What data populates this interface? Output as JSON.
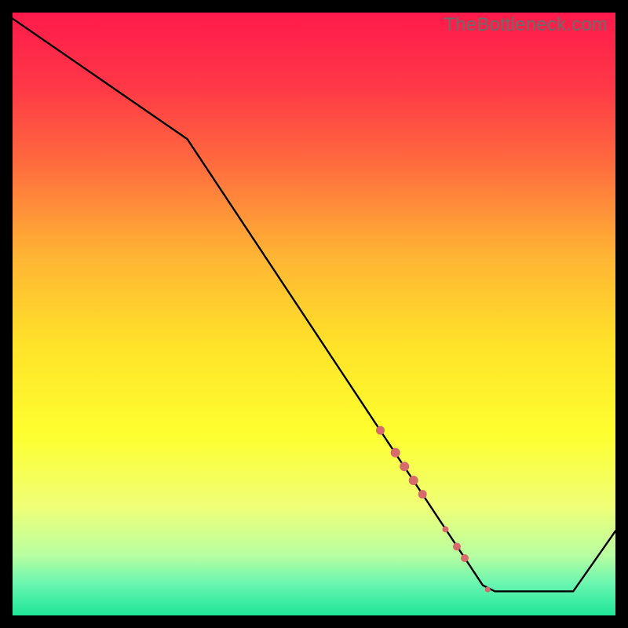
{
  "watermark": "TheBottleneck.com",
  "colors": {
    "frame": "#000000",
    "line": "#000000",
    "marker": "#d76a6a",
    "grad_stops": [
      {
        "p": 0.0,
        "c": "#ff1a4b"
      },
      {
        "p": 0.12,
        "c": "#ff3747"
      },
      {
        "p": 0.25,
        "c": "#ff6b3e"
      },
      {
        "p": 0.4,
        "c": "#ffb334"
      },
      {
        "p": 0.55,
        "c": "#ffe229"
      },
      {
        "p": 0.7,
        "c": "#feff2f"
      },
      {
        "p": 0.82,
        "c": "#efff77"
      },
      {
        "p": 0.9,
        "c": "#b8ffa1"
      },
      {
        "p": 0.95,
        "c": "#66f5b0"
      },
      {
        "p": 1.0,
        "c": "#1de597"
      }
    ]
  },
  "chart_data": {
    "type": "line",
    "title": "",
    "xlabel": "",
    "ylabel": "",
    "xlim": [
      0,
      100
    ],
    "ylim": [
      0,
      100
    ],
    "series": [
      {
        "name": "curve",
        "x": [
          0,
          29,
          78,
          80,
          86,
          93,
          100
        ],
        "y": [
          99,
          79,
          5,
          4,
          4,
          4,
          14
        ]
      }
    ],
    "markers": [
      {
        "x": 61.0,
        "y": 30.7,
        "r": 5.5
      },
      {
        "x": 63.5,
        "y": 27.0,
        "r": 6.0
      },
      {
        "x": 65.0,
        "y": 24.7,
        "r": 6.0
      },
      {
        "x": 66.5,
        "y": 22.4,
        "r": 6.0
      },
      {
        "x": 68.0,
        "y": 20.1,
        "r": 5.5
      },
      {
        "x": 71.8,
        "y": 14.3,
        "r": 4.0
      },
      {
        "x": 73.7,
        "y": 11.4,
        "r": 5.0
      },
      {
        "x": 75.0,
        "y": 9.5,
        "r": 5.0
      },
      {
        "x": 78.8,
        "y": 4.3,
        "r": 3.5
      }
    ]
  }
}
